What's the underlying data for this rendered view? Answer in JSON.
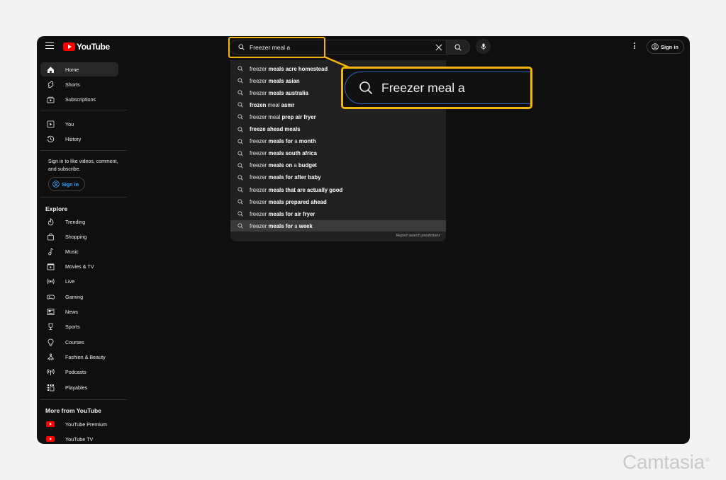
{
  "header": {
    "logo_text": "YouTube",
    "search": {
      "value": "Freezer meal a"
    },
    "sign_in_label": "Sign in"
  },
  "sidebar": {
    "primary": [
      {
        "label": "Home",
        "icon": "home-icon",
        "active": true
      },
      {
        "label": "Shorts",
        "icon": "shorts-icon"
      },
      {
        "label": "Subscriptions",
        "icon": "subscriptions-icon"
      }
    ],
    "you": [
      {
        "label": "You",
        "icon": "you-icon"
      },
      {
        "label": "History",
        "icon": "history-icon"
      }
    ],
    "signin_prompt": "Sign in to like videos, comment, and subscribe.",
    "signin_label": "Sign in",
    "explore_title": "Explore",
    "explore": [
      {
        "label": "Trending",
        "icon": "trending-icon"
      },
      {
        "label": "Shopping",
        "icon": "shopping-icon"
      },
      {
        "label": "Music",
        "icon": "music-icon"
      },
      {
        "label": "Movies & TV",
        "icon": "movies-icon"
      },
      {
        "label": "Live",
        "icon": "live-icon"
      },
      {
        "label": "Gaming",
        "icon": "gaming-icon"
      },
      {
        "label": "News",
        "icon": "news-icon"
      },
      {
        "label": "Sports",
        "icon": "sports-icon"
      },
      {
        "label": "Courses",
        "icon": "courses-icon"
      },
      {
        "label": "Fashion & Beauty",
        "icon": "fashion-icon"
      },
      {
        "label": "Podcasts",
        "icon": "podcasts-icon"
      },
      {
        "label": "Playables",
        "icon": "playables-icon"
      }
    ],
    "more_title": "More from YouTube",
    "more": [
      {
        "label": "YouTube Premium",
        "icon": "youtube-premium-icon"
      },
      {
        "label": "YouTube TV",
        "icon": "youtube-tv-icon"
      }
    ]
  },
  "suggestions": {
    "items": [
      {
        "plain": "freezer ",
        "bold": "meals acre homestead"
      },
      {
        "plain": "freezer ",
        "bold": "meals asian"
      },
      {
        "plain": "freezer ",
        "bold": "meals australia"
      },
      {
        "plain": "",
        "bold": "frozen",
        "rest": " meal ",
        "bold2": "asmr"
      },
      {
        "plain": "freezer meal ",
        "bold": "prep air fryer"
      },
      {
        "plain": "",
        "bold": "freeze ahead meals"
      },
      {
        "plain": "freezer ",
        "bold": "meals for",
        "rest": " a ",
        "bold2": "month"
      },
      {
        "plain": "freezer ",
        "bold": "meals south africa"
      },
      {
        "plain": "freezer ",
        "bold": "meals on",
        "rest": " a ",
        "bold2": "budget"
      },
      {
        "plain": "freezer ",
        "bold": "meals for after baby"
      },
      {
        "plain": "freezer ",
        "bold": "meals that are actually good"
      },
      {
        "plain": "freezer ",
        "bold": "meals prepared ahead"
      },
      {
        "plain": "freezer ",
        "bold": "meals for air fryer"
      },
      {
        "plain": "freezer ",
        "bold": "meals for",
        "rest": " a ",
        "bold2": "week",
        "active": true
      }
    ],
    "report_label": "Report search predictions"
  },
  "colors": {
    "highlight": "#f4b40e",
    "brand_red": "#ff0000",
    "link_blue": "#3ea6ff",
    "background": "#0f0f0f"
  },
  "watermark": {
    "text": "Camtasia",
    "mark": "®"
  }
}
